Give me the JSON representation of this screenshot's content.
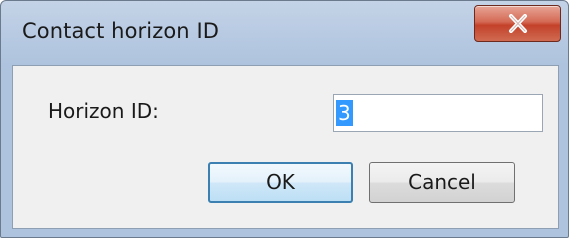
{
  "window": {
    "title": "Contact horizon ID",
    "close_icon": "close-icon"
  },
  "form": {
    "horizon_label": "Horizon ID:",
    "horizon_value": "3"
  },
  "buttons": {
    "ok_label": "OK",
    "cancel_label": "Cancel"
  },
  "colors": {
    "title_gradient_top": "#c4d3e6",
    "close_button_red": "#c4412a",
    "selection": "#3399ff",
    "ok_border": "#3c7fb1"
  }
}
